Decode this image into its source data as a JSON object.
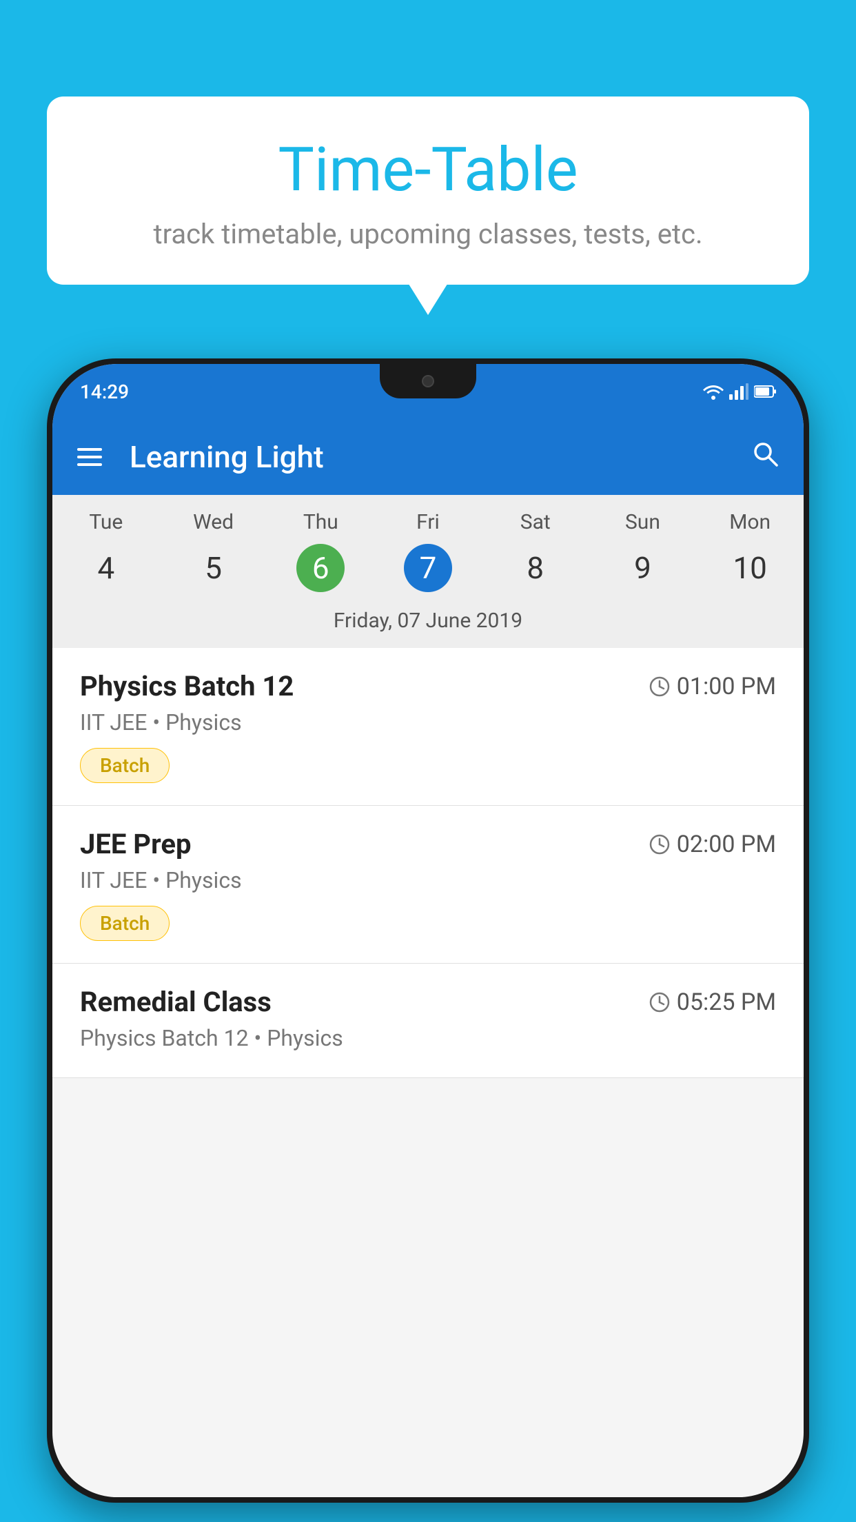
{
  "background_color": "#1bb8e8",
  "speech_bubble": {
    "title": "Time-Table",
    "subtitle": "track timetable, upcoming classes, tests, etc."
  },
  "phone": {
    "status_bar": {
      "time": "14:29",
      "icons": [
        "wifi",
        "signal",
        "battery"
      ]
    },
    "app_bar": {
      "title": "Learning Light",
      "menu_icon": "hamburger-icon",
      "search_icon": "search-icon"
    },
    "calendar": {
      "days": [
        {
          "name": "Tue",
          "number": "4",
          "state": "normal"
        },
        {
          "name": "Wed",
          "number": "5",
          "state": "normal"
        },
        {
          "name": "Thu",
          "number": "6",
          "state": "today"
        },
        {
          "name": "Fri",
          "number": "7",
          "state": "selected"
        },
        {
          "name": "Sat",
          "number": "8",
          "state": "normal"
        },
        {
          "name": "Sun",
          "number": "9",
          "state": "normal"
        },
        {
          "name": "Mon",
          "number": "10",
          "state": "normal"
        }
      ],
      "selected_date_label": "Friday, 07 June 2019"
    },
    "schedule_items": [
      {
        "title": "Physics Batch 12",
        "time": "01:00 PM",
        "subtitle": "IIT JEE • Physics",
        "tag": "Batch"
      },
      {
        "title": "JEE Prep",
        "time": "02:00 PM",
        "subtitle": "IIT JEE • Physics",
        "tag": "Batch"
      },
      {
        "title": "Remedial Class",
        "time": "05:25 PM",
        "subtitle": "Physics Batch 12 • Physics",
        "tag": null
      }
    ]
  }
}
